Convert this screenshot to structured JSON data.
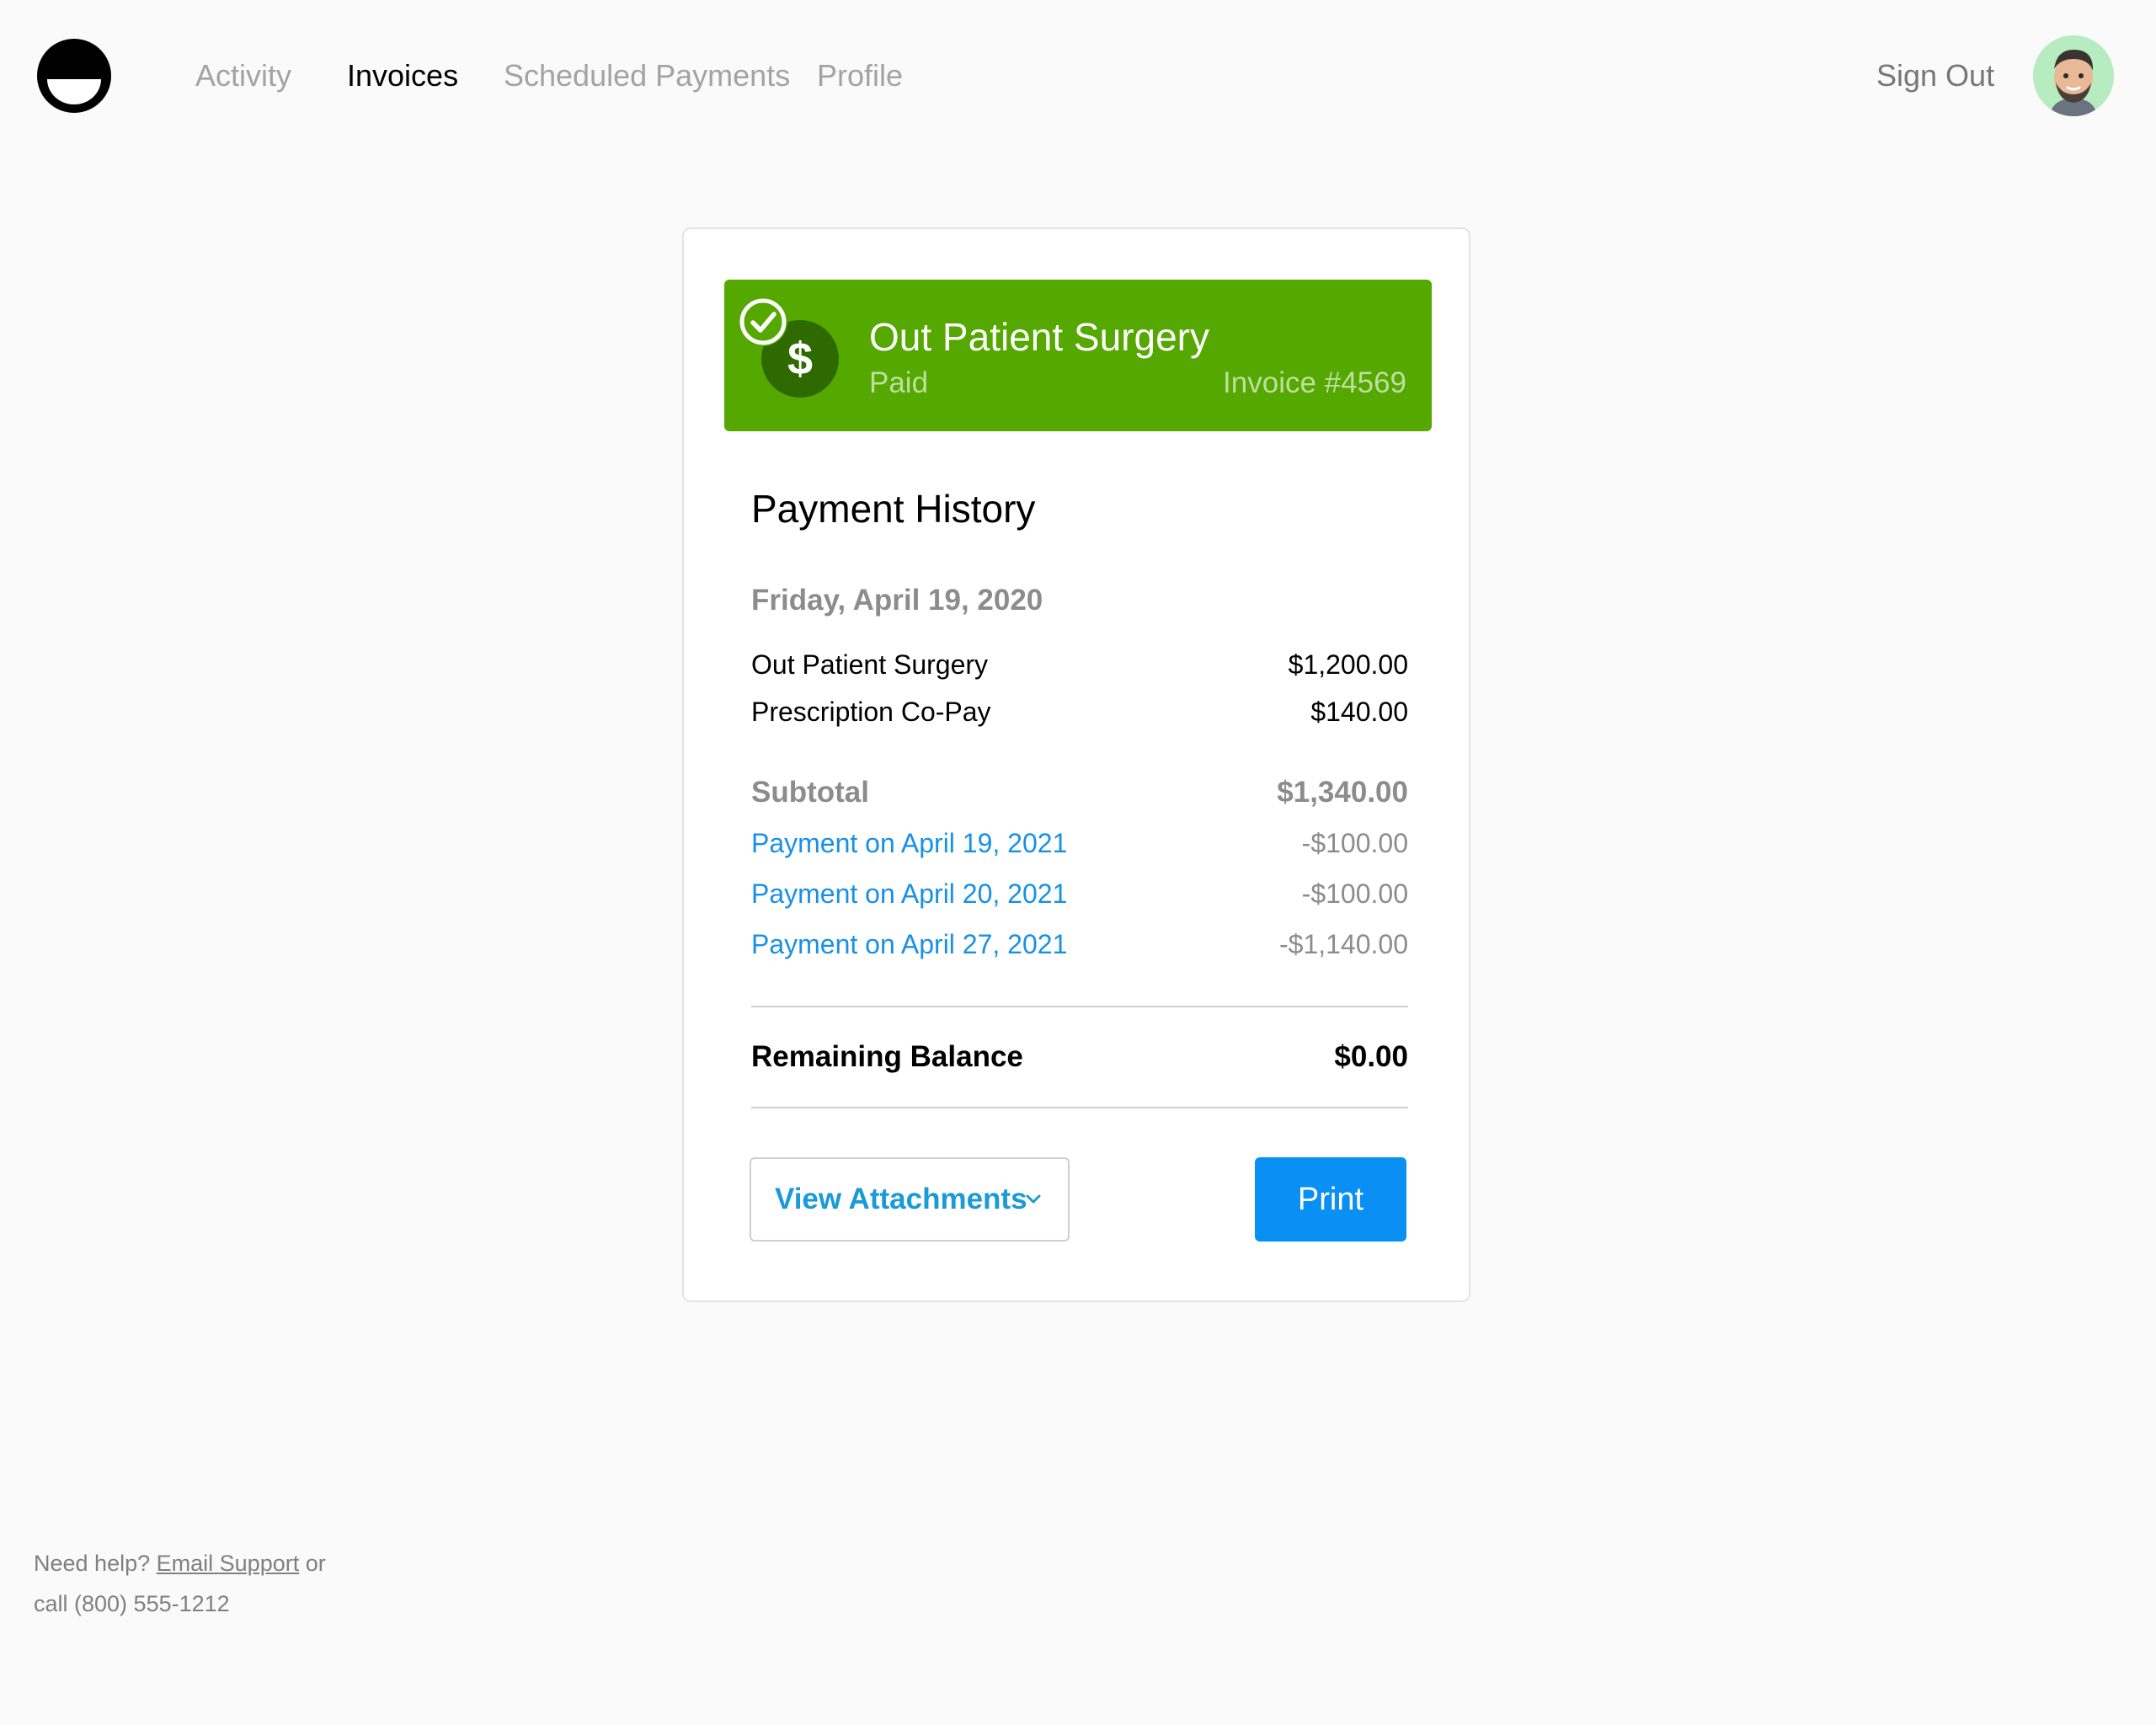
{
  "nav": {
    "logo_icon": "smile-logo-icon",
    "items": [
      {
        "label": "Activity",
        "active": false
      },
      {
        "label": "Invoices",
        "active": true
      },
      {
        "label": "Scheduled Payments",
        "active": false
      },
      {
        "label": "Profile",
        "active": false
      }
    ],
    "sign_out": "Sign Out",
    "avatar_icon": "user-avatar"
  },
  "invoice": {
    "icon": "paid-dollar-check-icon",
    "title": "Out Patient Surgery",
    "status": "Paid",
    "number": "Invoice #4569",
    "banner_color": "#54a800"
  },
  "history": {
    "title": "Payment History",
    "date": "Friday, April 19, 2020",
    "items": [
      {
        "label": "Out Patient Surgery",
        "amount": "$1,200.00"
      },
      {
        "label": "Prescription Co-Pay",
        "amount": "$140.00"
      }
    ],
    "subtotal": {
      "label": "Subtotal",
      "amount": "$1,340.00"
    },
    "payments": [
      {
        "label": "Payment on April 19, 2021",
        "amount": "-$100.00"
      },
      {
        "label": "Payment on April 20, 2021",
        "amount": "-$100.00"
      },
      {
        "label": "Payment on April 27, 2021",
        "amount": "-$1,140.00"
      }
    ],
    "balance": {
      "label": "Remaining Balance",
      "amount": "$0.00"
    }
  },
  "actions": {
    "attachments_label": "View Attachments",
    "attachments_icon": "chevron-down-icon",
    "print_label": "Print",
    "link_color": "#1890e8",
    "primary_color": "#0a90f4"
  },
  "footer": {
    "prefix": "Need help?",
    "email_link": "Email Support",
    "middle": "or",
    "call_text": "call (800) 555-1212"
  }
}
